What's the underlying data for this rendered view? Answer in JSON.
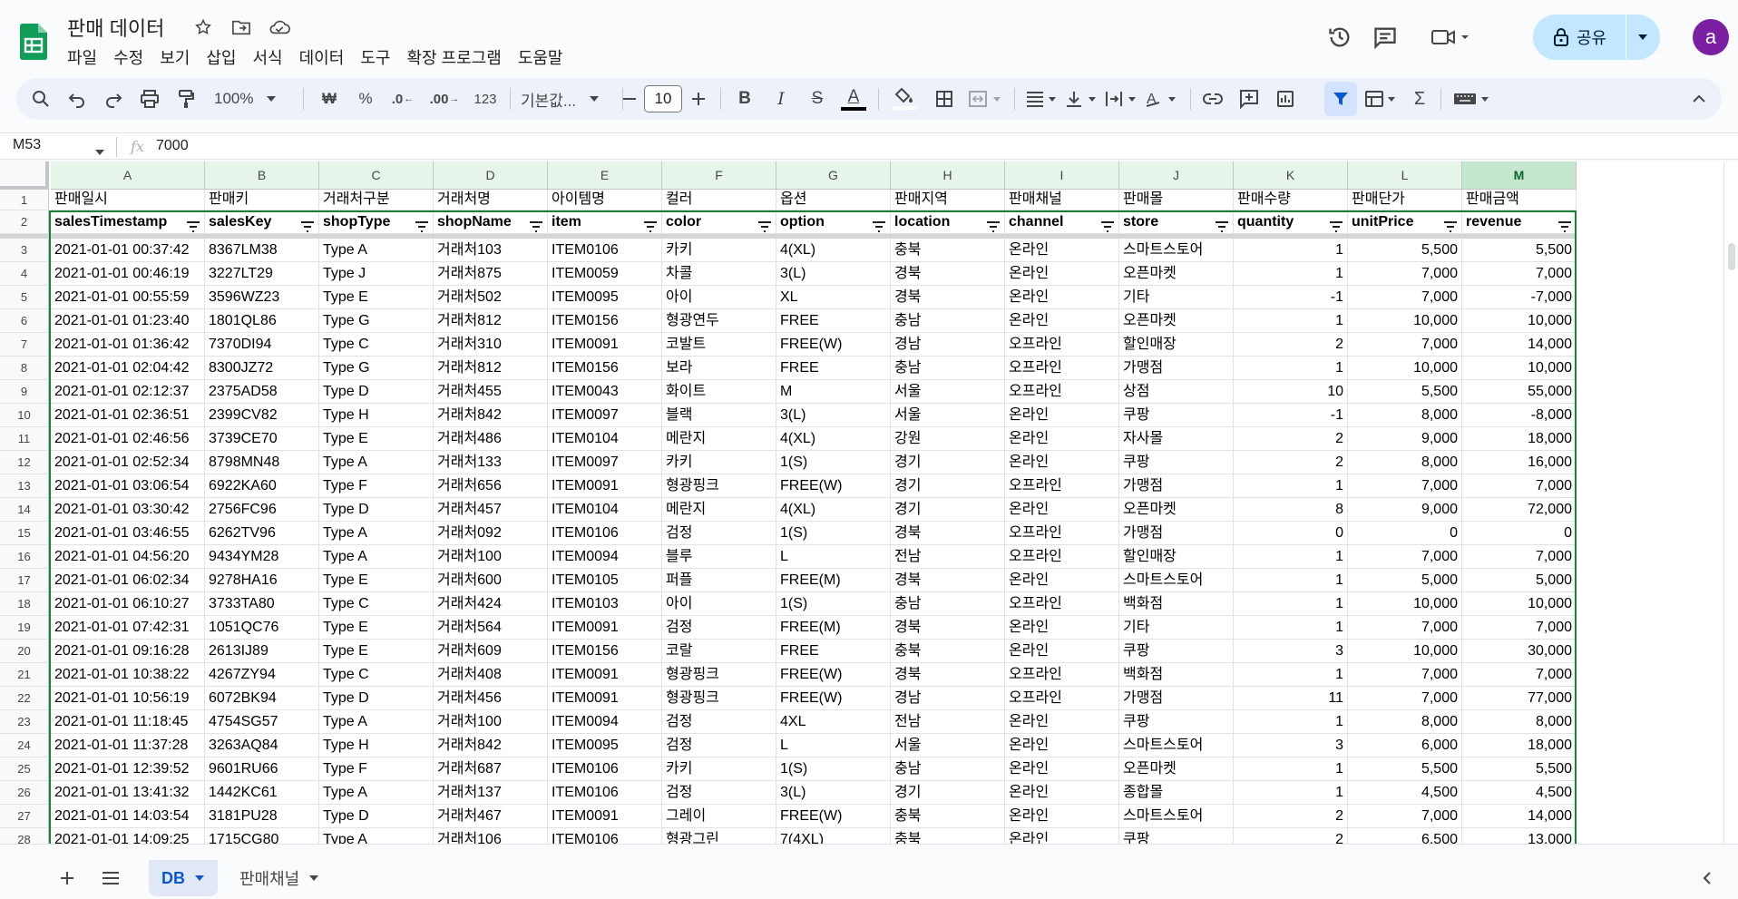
{
  "document": {
    "title": "판매 데이터"
  },
  "menu": [
    "파일",
    "수정",
    "보기",
    "삽입",
    "서식",
    "데이터",
    "도구",
    "확장 프로그램",
    "도움말"
  ],
  "header": {
    "share_label": "공유",
    "avatar_letter": "a"
  },
  "toolbar": {
    "zoom": "100%",
    "currency": "₩",
    "percent": "%",
    "dec_decrease": ".0",
    "dec_increase": ".00",
    "format_123": "123",
    "font": "기본값...",
    "font_size": "10"
  },
  "formula_bar": {
    "cell_ref": "M53",
    "fx": "fx",
    "value": "7000"
  },
  "columns": [
    "A",
    "B",
    "C",
    "D",
    "E",
    "F",
    "G",
    "H",
    "I",
    "J",
    "K",
    "L",
    "M"
  ],
  "selected_column": "M",
  "row1_headers": [
    "판매일시",
    "판매키",
    "거래처구분",
    "거래처명",
    "아이템명",
    "컬러",
    "옵션",
    "판매지역",
    "판매채널",
    "판매몰",
    "판매수량",
    "판매단가",
    "판매금액"
  ],
  "row2_fields": [
    "salesTimestamp",
    "salesKey",
    "shopType",
    "shopName",
    "item",
    "color",
    "option",
    "location",
    "channel",
    "store",
    "quantity",
    "unitPrice",
    "revenue"
  ],
  "rows": [
    {
      "n": "3",
      "v": [
        "2021-01-01 00:37:42",
        "8367LM38",
        "Type A",
        "거래처103",
        "ITEM0106",
        "카키",
        "4(XL)",
        "충북",
        "온라인",
        "스마트스토어",
        "1",
        "5,500",
        "5,500"
      ]
    },
    {
      "n": "4",
      "v": [
        "2021-01-01 00:46:19",
        "3227LT29",
        "Type J",
        "거래처875",
        "ITEM0059",
        "차콜",
        "3(L)",
        "경북",
        "온라인",
        "오픈마켓",
        "1",
        "7,000",
        "7,000"
      ]
    },
    {
      "n": "5",
      "v": [
        "2021-01-01 00:55:59",
        "3596WZ23",
        "Type E",
        "거래처502",
        "ITEM0095",
        "아이",
        "XL",
        "경북",
        "온라인",
        "기타",
        "-1",
        "7,000",
        "-7,000"
      ]
    },
    {
      "n": "6",
      "v": [
        "2021-01-01 01:23:40",
        "1801QL86",
        "Type G",
        "거래처812",
        "ITEM0156",
        "형광연두",
        "FREE",
        "충남",
        "온라인",
        "오픈마켓",
        "1",
        "10,000",
        "10,000"
      ]
    },
    {
      "n": "7",
      "v": [
        "2021-01-01 01:36:42",
        "7370DI94",
        "Type C",
        "거래처310",
        "ITEM0091",
        "코발트",
        "FREE(W)",
        "경남",
        "오프라인",
        "할인매장",
        "2",
        "7,000",
        "14,000"
      ]
    },
    {
      "n": "8",
      "v": [
        "2021-01-01 02:04:42",
        "8300JZ72",
        "Type G",
        "거래처812",
        "ITEM0156",
        "보라",
        "FREE",
        "충남",
        "오프라인",
        "가맹점",
        "1",
        "10,000",
        "10,000"
      ]
    },
    {
      "n": "9",
      "v": [
        "2021-01-01 02:12:37",
        "2375AD58",
        "Type D",
        "거래처455",
        "ITEM0043",
        "화이트",
        "M",
        "서울",
        "오프라인",
        "상점",
        "10",
        "5,500",
        "55,000"
      ]
    },
    {
      "n": "10",
      "v": [
        "2021-01-01 02:36:51",
        "2399CV82",
        "Type H",
        "거래처842",
        "ITEM0097",
        "블랙",
        "3(L)",
        "서울",
        "온라인",
        "쿠팡",
        "-1",
        "8,000",
        "-8,000"
      ]
    },
    {
      "n": "11",
      "v": [
        "2021-01-01 02:46:56",
        "3739CE70",
        "Type E",
        "거래처486",
        "ITEM0104",
        "메란지",
        "4(XL)",
        "강원",
        "온라인",
        "자사몰",
        "2",
        "9,000",
        "18,000"
      ]
    },
    {
      "n": "12",
      "v": [
        "2021-01-01 02:52:34",
        "8798MN48",
        "Type A",
        "거래처133",
        "ITEM0097",
        "카키",
        "1(S)",
        "경기",
        "온라인",
        "쿠팡",
        "2",
        "8,000",
        "16,000"
      ]
    },
    {
      "n": "13",
      "v": [
        "2021-01-01 03:06:54",
        "6922KA60",
        "Type F",
        "거래처656",
        "ITEM0091",
        "형광핑크",
        "FREE(W)",
        "경기",
        "오프라인",
        "가맹점",
        "1",
        "7,000",
        "7,000"
      ]
    },
    {
      "n": "14",
      "v": [
        "2021-01-01 03:30:42",
        "2756FC96",
        "Type D",
        "거래처457",
        "ITEM0104",
        "메란지",
        "4(XL)",
        "경기",
        "온라인",
        "오픈마켓",
        "8",
        "9,000",
        "72,000"
      ]
    },
    {
      "n": "15",
      "v": [
        "2021-01-01 03:46:55",
        "6262TV96",
        "Type A",
        "거래처092",
        "ITEM0106",
        "검정",
        "1(S)",
        "경북",
        "오프라인",
        "가맹점",
        "0",
        "0",
        "0"
      ]
    },
    {
      "n": "16",
      "v": [
        "2021-01-01 04:56:20",
        "9434YM28",
        "Type A",
        "거래처100",
        "ITEM0094",
        "블루",
        "L",
        "전남",
        "오프라인",
        "할인매장",
        "1",
        "7,000",
        "7,000"
      ]
    },
    {
      "n": "17",
      "v": [
        "2021-01-01 06:02:34",
        "9278HA16",
        "Type E",
        "거래처600",
        "ITEM0105",
        "퍼플",
        "FREE(M)",
        "경북",
        "온라인",
        "스마트스토어",
        "1",
        "5,000",
        "5,000"
      ]
    },
    {
      "n": "18",
      "v": [
        "2021-01-01 06:10:27",
        "3733TA80",
        "Type C",
        "거래처424",
        "ITEM0103",
        "아이",
        "1(S)",
        "충남",
        "오프라인",
        "백화점",
        "1",
        "10,000",
        "10,000"
      ]
    },
    {
      "n": "19",
      "v": [
        "2021-01-01 07:42:31",
        "1051QC76",
        "Type E",
        "거래처564",
        "ITEM0091",
        "검정",
        "FREE(M)",
        "경북",
        "온라인",
        "기타",
        "1",
        "7,000",
        "7,000"
      ]
    },
    {
      "n": "20",
      "v": [
        "2021-01-01 09:16:28",
        "2613IJ89",
        "Type E",
        "거래처609",
        "ITEM0156",
        "코랄",
        "FREE",
        "충북",
        "온라인",
        "쿠팡",
        "3",
        "10,000",
        "30,000"
      ]
    },
    {
      "n": "21",
      "v": [
        "2021-01-01 10:38:22",
        "4267ZY94",
        "Type C",
        "거래처408",
        "ITEM0091",
        "형광핑크",
        "FREE(W)",
        "경북",
        "오프라인",
        "백화점",
        "1",
        "7,000",
        "7,000"
      ]
    },
    {
      "n": "22",
      "v": [
        "2021-01-01 10:56:19",
        "6072BK94",
        "Type D",
        "거래처456",
        "ITEM0091",
        "형광핑크",
        "FREE(W)",
        "경남",
        "오프라인",
        "가맹점",
        "11",
        "7,000",
        "77,000"
      ]
    },
    {
      "n": "23",
      "v": [
        "2021-01-01 11:18:45",
        "4754SG57",
        "Type A",
        "거래처100",
        "ITEM0094",
        "검정",
        "4XL",
        "전남",
        "온라인",
        "쿠팡",
        "1",
        "8,000",
        "8,000"
      ]
    },
    {
      "n": "24",
      "v": [
        "2021-01-01 11:37:28",
        "3263AQ84",
        "Type H",
        "거래처842",
        "ITEM0095",
        "검정",
        "L",
        "서울",
        "온라인",
        "스마트스토어",
        "3",
        "6,000",
        "18,000"
      ]
    },
    {
      "n": "25",
      "v": [
        "2021-01-01 12:39:52",
        "9601RU66",
        "Type F",
        "거래처687",
        "ITEM0106",
        "카키",
        "1(S)",
        "충남",
        "온라인",
        "오픈마켓",
        "1",
        "5,500",
        "5,500"
      ]
    },
    {
      "n": "26",
      "v": [
        "2021-01-01 13:41:32",
        "1442KC61",
        "Type A",
        "거래처137",
        "ITEM0106",
        "검정",
        "3(L)",
        "경기",
        "온라인",
        "종합몰",
        "1",
        "4,500",
        "4,500"
      ]
    },
    {
      "n": "27",
      "v": [
        "2021-01-01 14:03:54",
        "3181PU28",
        "Type D",
        "거래처467",
        "ITEM0091",
        "그레이",
        "FREE(W)",
        "충북",
        "온라인",
        "스마트스토어",
        "2",
        "7,000",
        "14,000"
      ]
    },
    {
      "n": "28",
      "v": [
        "2021-01-01 14:09:25",
        "1715CG80",
        "Type A",
        "거래처106",
        "ITEM0106",
        "형광그린",
        "7(4XL)",
        "충북",
        "온라인",
        "쿠팡",
        "2",
        "6,500",
        "13,000"
      ]
    }
  ],
  "sheets": {
    "active": "DB",
    "other": "판매채널"
  },
  "colors": {
    "accent": "#0b57d0",
    "share_bg": "#c2e7ff",
    "sheets_green": "#188038",
    "avatar_bg": "#7b1fa2",
    "column_header_bg": "#e6f4ea",
    "selected_column_bg": "#c6e7cf"
  }
}
